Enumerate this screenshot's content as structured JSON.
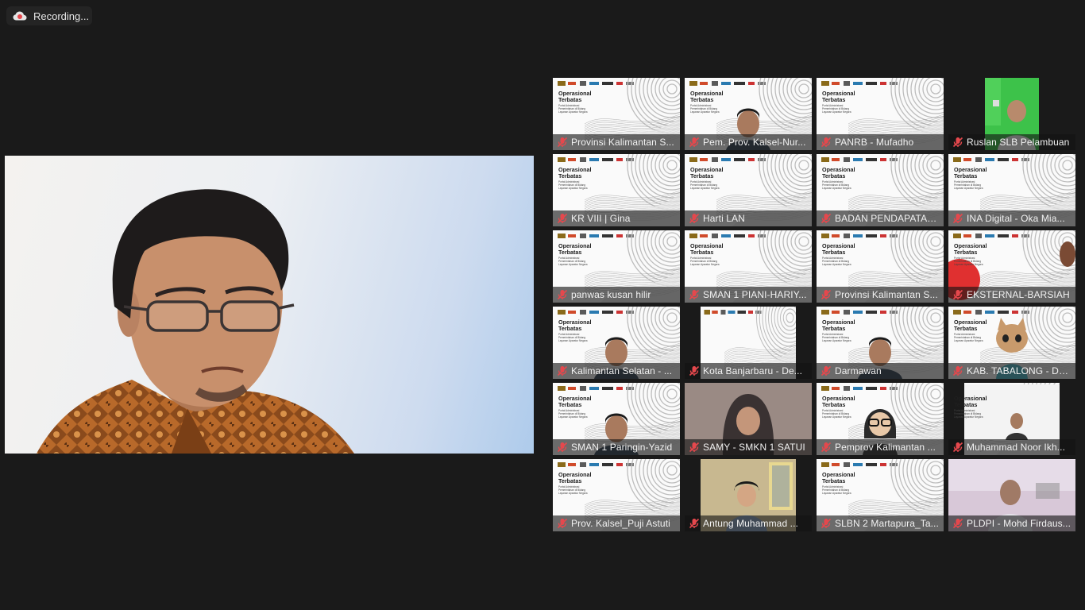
{
  "recording": {
    "label": "Recording...",
    "icon": "cloud-record-icon",
    "color": "#e5484d"
  },
  "speaker": {
    "icon": "speaker-video"
  },
  "slide": {
    "title_line1": "Operasional",
    "title_line2": "Terbatas",
    "sub_line1": "Portal Administrasi",
    "sub_line2": "Pemerintahan di Bidang",
    "sub_line3": "Layanan Aparatur Negara"
  },
  "participants": [
    {
      "name": "Provinsi Kalimantan S...",
      "type": "slide"
    },
    {
      "name": "Pem. Prov. Kalsel-Nur...",
      "type": "slide-person"
    },
    {
      "name": "PANRB - Mufadho",
      "type": "slide"
    },
    {
      "name": "Ruslan SLB Pelambuan",
      "type": "camera-green"
    },
    {
      "name": "KR VIII | Gina",
      "type": "slide"
    },
    {
      "name": "Harti LAN",
      "type": "slide"
    },
    {
      "name": "BADAN PENDAPATAN...",
      "type": "slide"
    },
    {
      "name": "INA Digital - Oka Mia...",
      "type": "slide"
    },
    {
      "name": "panwas kusan hilir",
      "type": "slide"
    },
    {
      "name": "SMAN 1 PIANI-HARIY...",
      "type": "slide"
    },
    {
      "name": "Provinsi Kalimantan S...",
      "type": "slide"
    },
    {
      "name": "EKSTERNAL-BARSIAH",
      "type": "slide-red"
    },
    {
      "name": "Kalimantan Selatan - ...",
      "type": "slide-person"
    },
    {
      "name": "Kota Banjarbaru - De...",
      "type": "slide-narrow"
    },
    {
      "name": "Darmawan",
      "type": "slide-person"
    },
    {
      "name": "KAB. TABALONG - DH...",
      "type": "slide-avatar"
    },
    {
      "name": "SMAN 1 Paringin-Yazid",
      "type": "slide-person"
    },
    {
      "name": "SAMY - SMKN 1 SATUI",
      "type": "camera-hijab"
    },
    {
      "name": "Pemprov Kalimantan ...",
      "type": "slide-avatar2"
    },
    {
      "name": "Muhammad Noor Ikh...",
      "type": "slide-inset"
    },
    {
      "name": "Prov. Kalsel_Puji Astuti",
      "type": "slide"
    },
    {
      "name": "Antung Muhammad ...",
      "type": "camera-office"
    },
    {
      "name": "SLBN 2 Martapura_Ta...",
      "type": "slide"
    },
    {
      "name": "PLDPI - Mohd Firdaus...",
      "type": "camera-purple"
    }
  ]
}
